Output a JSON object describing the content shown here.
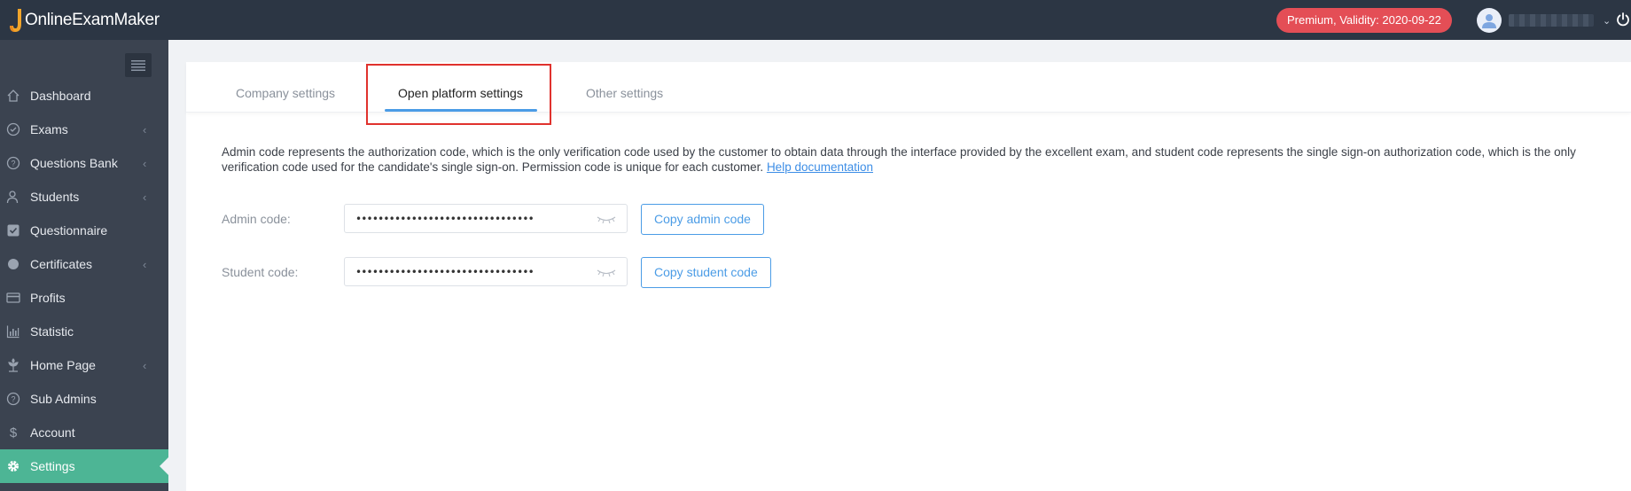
{
  "header": {
    "logo_text": "OnlineExamMaker",
    "badge": "Premium, Validity: 2020-09-22",
    "icons": [
      "logo-icon",
      "avatar-icon",
      "chevron-down-icon",
      "power-icon"
    ]
  },
  "sidebar": {
    "items": [
      {
        "label": "Dashboard",
        "icon": "home-icon",
        "has_arrow": false
      },
      {
        "label": "Exams",
        "icon": "check-circle-icon",
        "has_arrow": true
      },
      {
        "label": "Questions Bank",
        "icon": "question-circle-icon",
        "has_arrow": true
      },
      {
        "label": "Students",
        "icon": "users-icon",
        "has_arrow": true
      },
      {
        "label": "Questionnaire",
        "icon": "checkbox-icon",
        "has_arrow": false
      },
      {
        "label": "Certificates",
        "icon": "certificate-icon",
        "has_arrow": true
      },
      {
        "label": "Profits",
        "icon": "credit-card-icon",
        "has_arrow": false
      },
      {
        "label": "Statistic",
        "icon": "bar-chart-icon",
        "has_arrow": false
      },
      {
        "label": "Home Page",
        "icon": "plant-icon",
        "has_arrow": true
      },
      {
        "label": "Sub Admins",
        "icon": "question-circle-icon",
        "has_arrow": false
      },
      {
        "label": "Account",
        "icon": "dollar-icon",
        "has_arrow": false
      },
      {
        "label": "Settings",
        "icon": "gear-icon",
        "has_arrow": false,
        "active": true
      }
    ]
  },
  "tabs": [
    {
      "label": "Company settings",
      "active": false
    },
    {
      "label": "Open platform settings",
      "active": true
    },
    {
      "label": "Other settings",
      "active": false
    }
  ],
  "description": {
    "text": "Admin code represents the authorization code, which is the only verification code used by the customer to obtain data through the interface provided by the excellent exam, and student code represents the single sign-on authorization code, which is the only verification code used for the candidate's single sign-on. Permission code is unique for each customer.",
    "link": "Help documentation"
  },
  "form": {
    "admin_label": "Admin code:",
    "admin_value": "••••••••••••••••••••••••••••••••",
    "admin_button": "Copy admin code",
    "student_label": "Student code:",
    "student_value": "••••••••••••••••••••••••••••••••",
    "student_button": "Copy student code"
  },
  "colors": {
    "topbar": "#2c3644",
    "sidebar": "#3b4350",
    "active_item": "#4db595",
    "badge": "#e44e56",
    "accent": "#4b9ce6",
    "highlight_box": "#e0322d"
  }
}
